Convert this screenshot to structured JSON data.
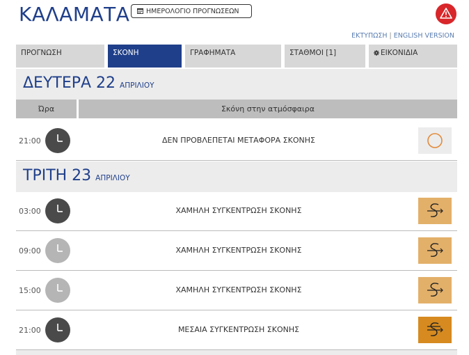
{
  "header": {
    "city": "ΚΑΛΑΜΑΤΑ",
    "calendar_button": "ΗΜΕΡΟΛΟΓΙΟ ΠΡΟΓΝΩΣΕΩΝ",
    "print_link": "ΕΚΤΥΠΩΣΗ",
    "separator": "|",
    "english_link": "ENGLISH VERSION",
    "alert_color": "#d8262a"
  },
  "tabs": [
    {
      "label": "ΠΡΟΓΝΩΣΗ"
    },
    {
      "label": "ΣΚΟΝΗ"
    },
    {
      "label": "ΓΡΑΦΗΜΑΤΑ"
    },
    {
      "label": "ΣΤΑΘΜΟΙ [1]"
    },
    {
      "label": "ΕΙΚΟΝΙΔΙΑ"
    }
  ],
  "days": [
    {
      "name": "ΔΕΥΤΕΡΑ 22",
      "month": "ΑΠΡΙΛΙΟΥ"
    },
    {
      "name": "ΤΡΙΤΗ 23",
      "month": "ΑΠΡΙΛΙΟΥ"
    }
  ],
  "columns": {
    "time": "Ώρα",
    "dust": "Σκόνη στην ατμόσφαιρα"
  },
  "rows": [
    {
      "time": "21:00",
      "clock": "night",
      "desc": "ΔΕΝ ΠΡΟΒΛΕΠΕΤΑΙ ΜΕΤΑΦΟΡΑ ΣΚΟΝΗΣ",
      "level": "none",
      "color": "#ececec"
    },
    {
      "time": "03:00",
      "clock": "night",
      "desc": "ΧΑΜΗΛΗ ΣΥΓΚΕΝΤΡΩΣΗ ΣΚΟΝΗΣ",
      "level": "low",
      "color": "#e3b06a"
    },
    {
      "time": "09:00",
      "clock": "day",
      "desc": "ΧΑΜΗΛΗ ΣΥΓΚΕΝΤΡΩΣΗ ΣΚΟΝΗΣ",
      "level": "low",
      "color": "#e3b06a"
    },
    {
      "time": "15:00",
      "clock": "day",
      "desc": "ΧΑΜΗΛΗ ΣΥΓΚΕΝΤΡΩΣΗ ΣΚΟΝΗΣ",
      "level": "low",
      "color": "#e3b06a"
    },
    {
      "time": "21:00",
      "clock": "night",
      "desc": "ΜΕΣΑΙΑ ΣΥΓΚΕΝΤΡΩΣΗ ΣΚΟΝΗΣ",
      "level": "medium",
      "color": "#d68a1f"
    }
  ]
}
